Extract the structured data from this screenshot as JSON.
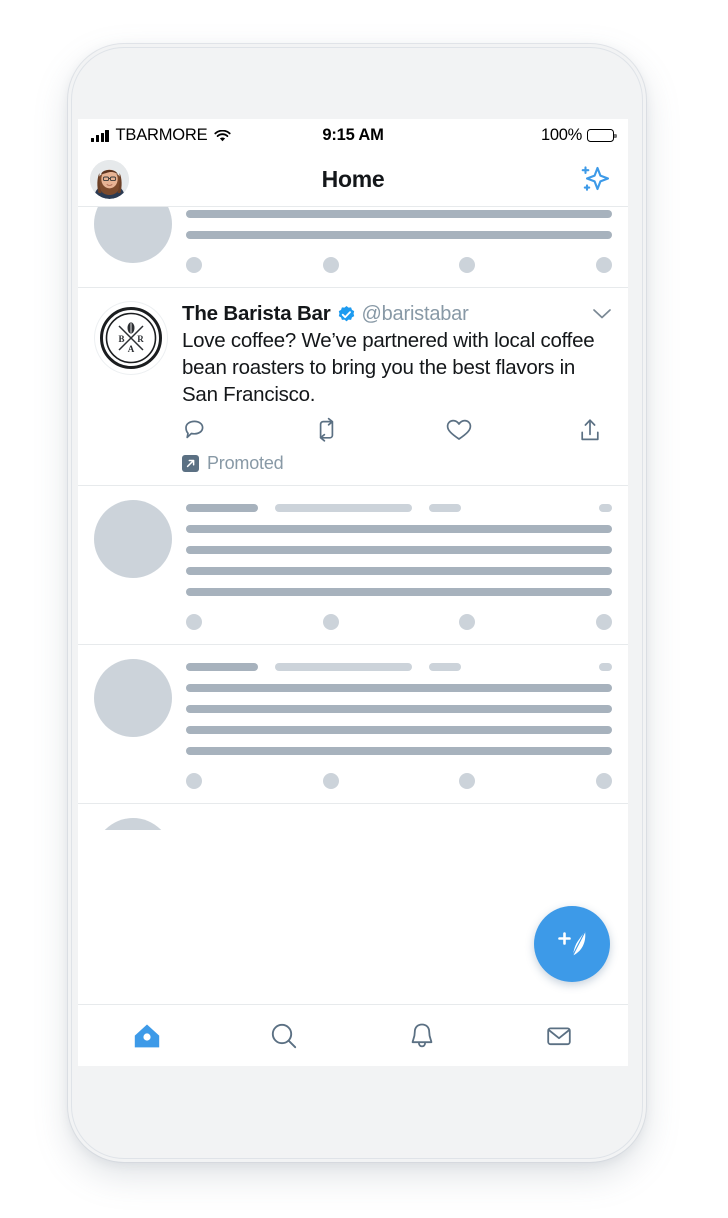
{
  "device": {
    "frame_color": "#f2f3f4",
    "screen_bg": "#ffffff"
  },
  "status_bar": {
    "carrier": "TBARMORE",
    "time": "9:15 AM",
    "battery_percent": "100%",
    "signal_icon": "cellular-bars-icon",
    "wifi_icon": "wifi-icon",
    "battery_icon": "battery-full-icon"
  },
  "header": {
    "title": "Home",
    "avatar_icon": "user-avatar",
    "sparkle_icon": "sparkle-icon",
    "sparkle_color": "#3d9ae8"
  },
  "feed": {
    "cards": [
      {
        "kind": "skeleton",
        "clipped": "top",
        "lines": [
          100,
          100,
          100
        ],
        "actions": 4
      },
      {
        "kind": "promoted",
        "display_name": "The Barista Bar",
        "verified": true,
        "handle": "@baristabar",
        "text": "Love coffee? We’ve partnered with local coffee bean roasters to bring you the best flavors in San Francisco.",
        "avatar_icon": "barista-bar-logo",
        "caret_icon": "chevron-down-icon",
        "actions": [
          {
            "name": "reply-icon",
            "label": "Reply"
          },
          {
            "name": "retweet-icon",
            "label": "Retweet"
          },
          {
            "name": "like-icon",
            "label": "Like"
          },
          {
            "name": "share-icon",
            "label": "Share"
          }
        ],
        "promoted_label": "Promoted",
        "promoted_icon": "promoted-arrow-icon"
      },
      {
        "kind": "skeleton",
        "clipped": "none",
        "meta": true,
        "lines": [
          100,
          100,
          100,
          100
        ],
        "actions": 4
      },
      {
        "kind": "skeleton",
        "clipped": "none",
        "meta": true,
        "lines": [
          100,
          100,
          100,
          100
        ],
        "actions": 4
      },
      {
        "kind": "skeleton",
        "clipped": "bottom"
      }
    ]
  },
  "compose": {
    "label": "Compose Tweet",
    "icon": "feather-plus-icon",
    "color": "#3d9ae8"
  },
  "tab_bar": {
    "active": "home",
    "tabs": [
      {
        "key": "home",
        "icon": "home-icon",
        "label": "Home",
        "active": true
      },
      {
        "key": "search",
        "icon": "search-icon",
        "label": "Search",
        "active": false
      },
      {
        "key": "notifications",
        "icon": "bell-icon",
        "label": "Notifications",
        "active": false
      },
      {
        "key": "messages",
        "icon": "envelope-icon",
        "label": "Messages",
        "active": false
      }
    ],
    "active_color": "#3d9ae8",
    "inactive_color": "#5b7083"
  },
  "colors": {
    "accent": "#3d9ae8",
    "text": "#14171a",
    "muted": "#8899a6",
    "skeleton_dark": "#a7b2bd",
    "skeleton_light": "#ccd3da",
    "divider": "#e7eaec"
  }
}
